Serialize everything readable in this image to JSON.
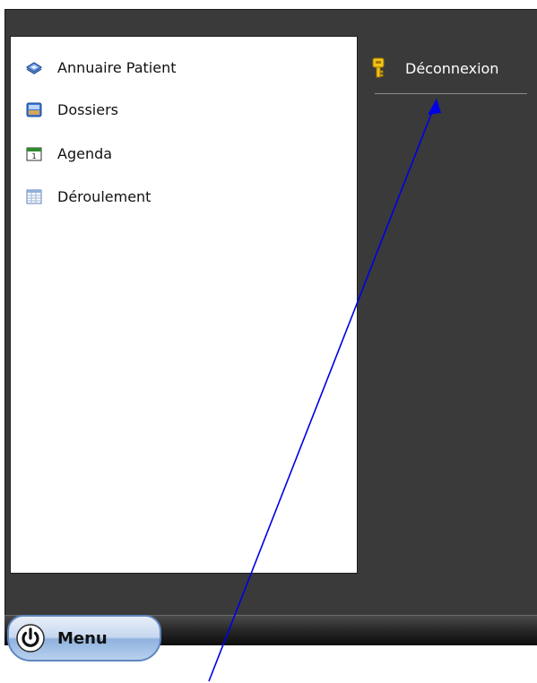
{
  "start_menu": {
    "items": [
      {
        "label": "Annuaire Patient",
        "icon": "address-book-icon"
      },
      {
        "label": "Dossiers",
        "icon": "folder-icon"
      },
      {
        "label": "Agenda",
        "icon": "calendar-icon"
      },
      {
        "label": "Déroulement",
        "icon": "table-grid-icon"
      }
    ],
    "logout": {
      "label": "Déconnexion",
      "icon": "key-icon"
    }
  },
  "taskbar": {
    "menu_label": "Menu",
    "menu_icon": "power-icon"
  },
  "annotation": {
    "arrow_color": "#0000e6"
  }
}
